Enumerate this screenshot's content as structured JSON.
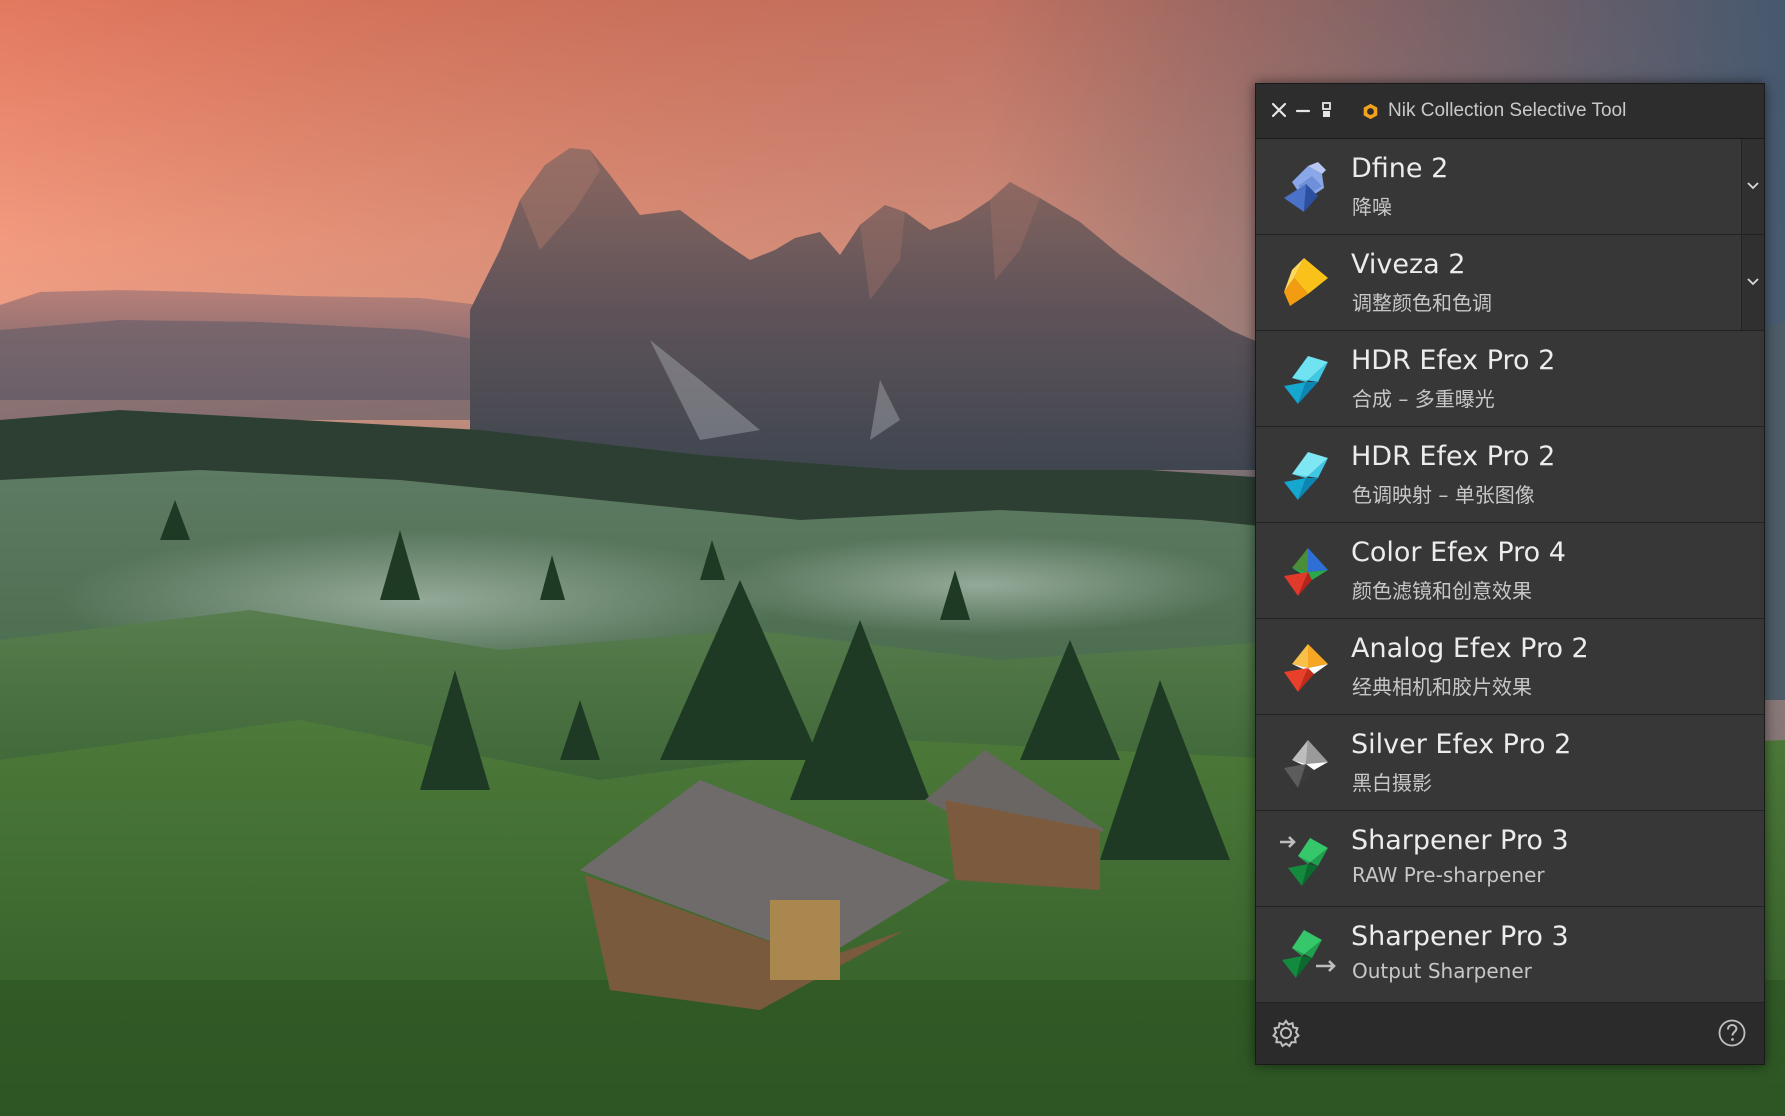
{
  "panel": {
    "title": "Nik Collection Selective Tool",
    "window_buttons": [
      {
        "icon": "close-icon"
      },
      {
        "icon": "minimize-icon"
      },
      {
        "icon": "layout-toggle-icon"
      }
    ]
  },
  "tools": [
    {
      "name": "Dfine 2",
      "subtitle": "降噪",
      "icon": "dfine-icon",
      "has_dropdown": true
    },
    {
      "name": "Viveza 2",
      "subtitle": "调整颜色和色调",
      "icon": "viveza-icon",
      "has_dropdown": true
    },
    {
      "name": "HDR Efex Pro 2",
      "subtitle": "合成 – 多重曝光",
      "icon": "hdr-efex-icon",
      "has_dropdown": false
    },
    {
      "name": "HDR Efex Pro 2",
      "subtitle": "色调映射 – 单张图像",
      "icon": "hdr-efex-icon",
      "has_dropdown": false
    },
    {
      "name": "Color Efex Pro 4",
      "subtitle": "颜色滤镜和创意效果",
      "icon": "color-efex-icon",
      "has_dropdown": false
    },
    {
      "name": "Analog Efex Pro 2",
      "subtitle": "经典相机和胶片效果",
      "icon": "analog-efex-icon",
      "has_dropdown": false
    },
    {
      "name": "Silver Efex Pro 2",
      "subtitle": "黑白摄影",
      "icon": "silver-efex-icon",
      "has_dropdown": false
    },
    {
      "name": "Sharpener Pro 3",
      "subtitle": "RAW Pre-sharpener",
      "icon": "sharpener-raw-icon",
      "has_dropdown": false
    },
    {
      "name": "Sharpener Pro 3",
      "subtitle": "Output Sharpener",
      "icon": "sharpener-output-icon",
      "has_dropdown": false
    }
  ],
  "footer": {
    "settings_icon": "gear-icon",
    "help_icon": "help-icon"
  },
  "colors": {
    "panel_bg": "#2b2b2b",
    "item_bg": "#373737",
    "text_primary": "#ececec",
    "text_secondary": "#c7c7c7"
  }
}
